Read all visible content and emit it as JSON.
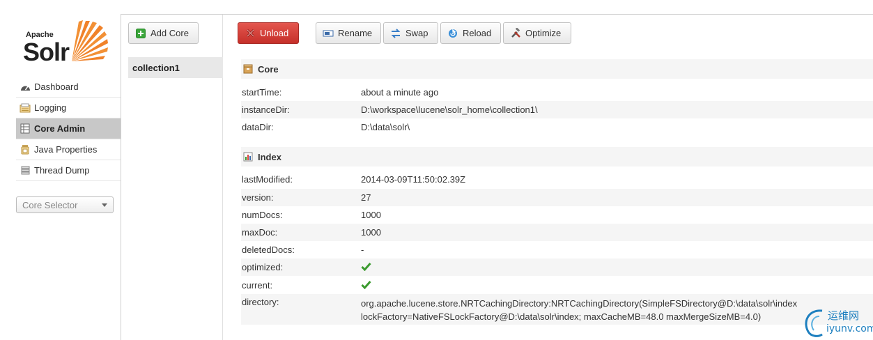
{
  "logo": {
    "apache": "Apache",
    "solr": "Solr"
  },
  "nav": [
    {
      "label": "Dashboard",
      "icon": "dashboard-icon",
      "active": false
    },
    {
      "label": "Logging",
      "icon": "logging-icon",
      "active": false
    },
    {
      "label": "Core Admin",
      "icon": "core-admin-icon",
      "active": true
    },
    {
      "label": "Java Properties",
      "icon": "java-properties-icon",
      "active": false
    },
    {
      "label": "Thread Dump",
      "icon": "thread-dump-icon",
      "active": false
    }
  ],
  "core_selector": {
    "placeholder": "Core Selector"
  },
  "cores": {
    "add_label": "Add Core",
    "items": [
      "collection1"
    ]
  },
  "toolbar": {
    "unload": "Unload",
    "rename": "Rename",
    "swap": "Swap",
    "reload": "Reload",
    "optimize": "Optimize"
  },
  "core_section": {
    "title": "Core",
    "rows": [
      {
        "key": "startTime:",
        "value": "about a minute ago"
      },
      {
        "key": "instanceDir:",
        "value": "D:\\workspace\\lucene\\solr_home\\collection1\\"
      },
      {
        "key": "dataDir:",
        "value": "D:\\data\\solr\\"
      }
    ]
  },
  "index_section": {
    "title": "Index",
    "rows": [
      {
        "key": "lastModified:",
        "value": "2014-03-09T11:50:02.39Z"
      },
      {
        "key": "version:",
        "value": "27"
      },
      {
        "key": "numDocs:",
        "value": "1000"
      },
      {
        "key": "maxDoc:",
        "value": "1000"
      },
      {
        "key": "deletedDocs:",
        "value": "-"
      },
      {
        "key": "optimized:",
        "value": ""
      },
      {
        "key": "current:",
        "value": ""
      },
      {
        "key": "directory:",
        "value_line1": "org.apache.lucene.store.NRTCachingDirectory:NRTCachingDirectory(SimpleFSDirectory@D:\\data\\solr\\index",
        "value_line2": "lockFactory=NativeFSLockFactory@D:\\data\\solr\\index; maxCacheMB=48.0 maxMergeSizeMB=4.0)"
      }
    ]
  },
  "colors": {
    "unload_red": "#d9443c",
    "check_green": "#3a9a2e",
    "active_nav": "#c8c8c8"
  },
  "watermark": {
    "cn": "运维网",
    "url": "iyunv.com"
  }
}
